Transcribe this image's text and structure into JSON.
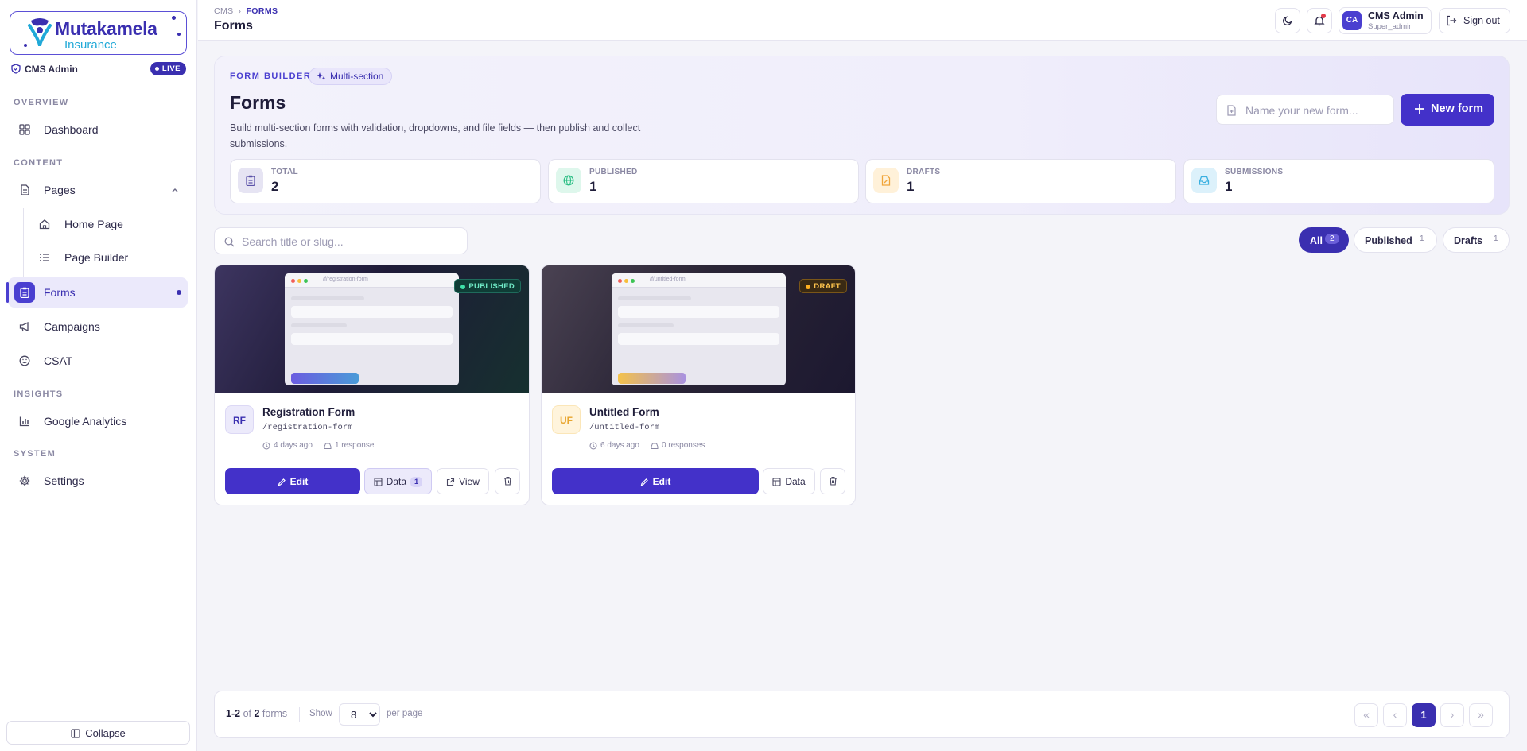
{
  "brand": {
    "name": "Mutakamela",
    "sub": "Insurance"
  },
  "sidebar": {
    "role": "CMS Admin",
    "live": "LIVE",
    "sections": {
      "overview": "OVERVIEW",
      "content": "CONTENT",
      "insights": "INSIGHTS",
      "system": "SYSTEM"
    },
    "items": {
      "dashboard": "Dashboard",
      "pages": "Pages",
      "home_page": "Home Page",
      "page_builder": "Page Builder",
      "forms": "Forms",
      "campaigns": "Campaigns",
      "csat": "CSAT",
      "analytics": "Google Analytics",
      "settings": "Settings"
    },
    "collapse": "Collapse"
  },
  "header": {
    "breadcrumb": [
      "CMS",
      "FORMS"
    ],
    "title": "Forms",
    "user": {
      "initials": "CA",
      "name": "CMS Admin",
      "role": "Super_admin"
    },
    "signout": "Sign out"
  },
  "hero": {
    "eyebrow": "FORM BUILDER",
    "chip": "Multi-section",
    "title": "Forms",
    "description": "Build multi-section forms with validation, dropdowns, and file fields — then publish and collect submissions.",
    "name_placeholder": "Name your new form...",
    "new_button": "New form",
    "stats": [
      {
        "label": "TOTAL",
        "value": "2"
      },
      {
        "label": "PUBLISHED",
        "value": "1"
      },
      {
        "label": "DRAFTS",
        "value": "1"
      },
      {
        "label": "SUBMISSIONS",
        "value": "1"
      }
    ]
  },
  "toolbar": {
    "search_placeholder": "Search title or slug...",
    "filters": [
      {
        "label": "All",
        "count": "2"
      },
      {
        "label": "Published",
        "count": "1"
      },
      {
        "label": "Drafts",
        "count": "1"
      }
    ]
  },
  "cards": [
    {
      "initials": "RF",
      "title": "Registration Form",
      "slug": "/registration-form",
      "url": "/f/registration-form",
      "status": "PUBLISHED",
      "updated": "4 days ago",
      "responses": "1 response",
      "edit": "Edit",
      "data": "Data",
      "data_count": "1",
      "view": "View"
    },
    {
      "initials": "UF",
      "title": "Untitled Form",
      "slug": "/untitled-form",
      "url": "/f/untitled-form",
      "status": "DRAFT",
      "updated": "6 days ago",
      "responses": "0 responses",
      "edit": "Edit",
      "data": "Data"
    }
  ],
  "pagination": {
    "range": "1-2",
    "of": "of",
    "total": "2",
    "unit": "forms",
    "show": "Show",
    "per_page_value": "8",
    "per_page_label": "per page",
    "current": "1"
  },
  "colors": {
    "accent": "#4331c9",
    "published": "#3ee0a8",
    "draft": "#ffb020"
  }
}
